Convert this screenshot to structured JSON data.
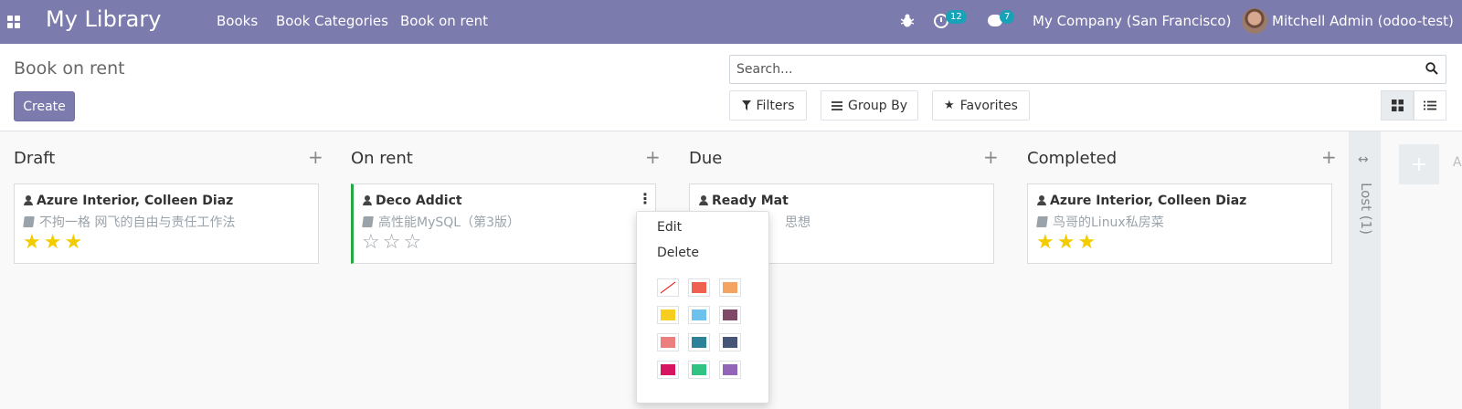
{
  "navbar": {
    "app_name": "My Library",
    "menu": [
      "Books",
      "Book Categories",
      "Book on rent"
    ],
    "activity_count": "12",
    "message_count": "7",
    "company": "My Company (San Francisco)",
    "user": "Mitchell Admin (odoo-test)"
  },
  "control_panel": {
    "title": "Book on rent",
    "create_label": "Create",
    "search_placeholder": "Search...",
    "filters_label": "Filters",
    "groupby_label": "Group By",
    "favorites_label": "Favorites"
  },
  "columns": [
    {
      "title": "Draft",
      "cards": [
        {
          "title": "Azure Interior, Colleen Diaz",
          "book": "不拘一格 网飞的自由与责任工作法",
          "rating": 3
        }
      ]
    },
    {
      "title": "On rent",
      "cards": [
        {
          "title": "Deco Addict",
          "book": "高性能MySQL（第3版）",
          "rating": 0
        }
      ]
    },
    {
      "title": "Due",
      "cards": [
        {
          "title": "Ready Mat",
          "book": "思想",
          "rating": null
        }
      ]
    },
    {
      "title": "Completed",
      "cards": [
        {
          "title": "Azure Interior, Colleen Diaz",
          "book": "鸟哥的Linux私房菜",
          "rating": 3
        }
      ]
    }
  ],
  "folded_column": {
    "label": "Lost (1)"
  },
  "add_column_text": "A",
  "dropdown": {
    "edit": "Edit",
    "delete": "Delete",
    "colors": [
      "none",
      "#f06050",
      "#f4a460",
      "#f7cd1f",
      "#6cc1ed",
      "#814968",
      "#eb7e7f",
      "#2c8397",
      "#475577",
      "#d6145f",
      "#30c381",
      "#9365b8"
    ]
  }
}
